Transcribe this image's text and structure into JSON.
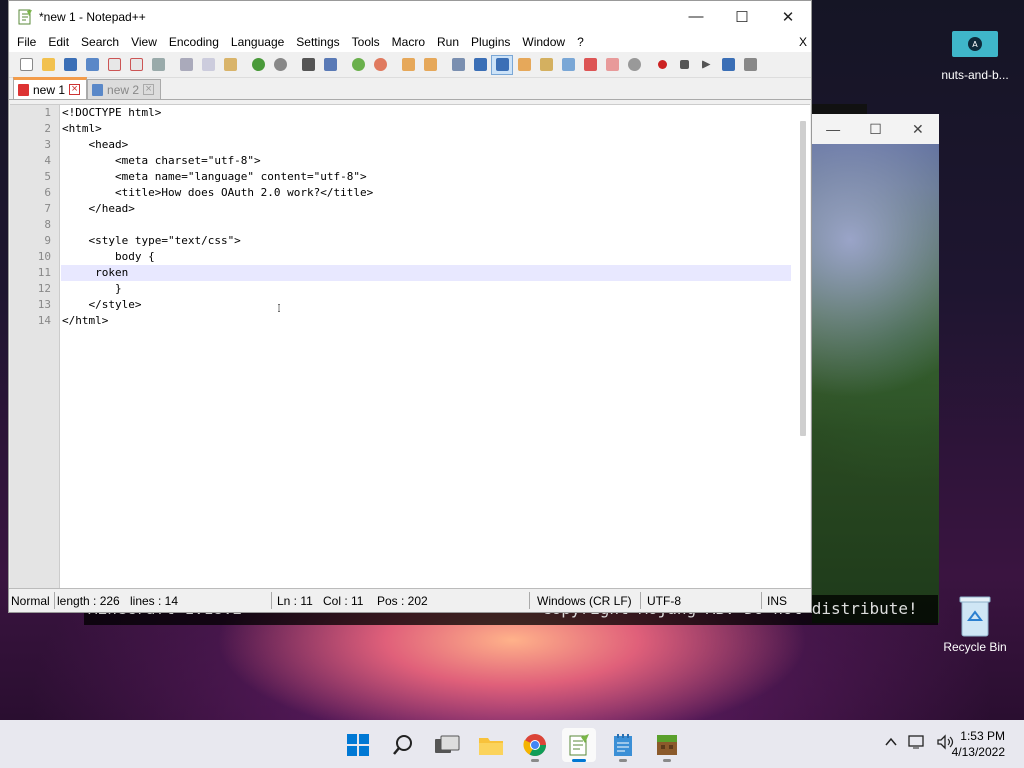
{
  "desktop": {
    "top_right_icon_label": "nuts-and-b...",
    "recycle_bin_label": "Recycle Bin"
  },
  "minecraft": {
    "version_text": "Minecraft 1.18.2",
    "copyright_text": "Copyright Mojang AB. Do not distribute!"
  },
  "notepad": {
    "window_title": "*new 1 - Notepad++",
    "menu": [
      "File",
      "Edit",
      "Search",
      "View",
      "Encoding",
      "Language",
      "Settings",
      "Tools",
      "Macro",
      "Run",
      "Plugins",
      "Window",
      "?"
    ],
    "menu_close": "X",
    "tabs": [
      {
        "label": "new 1",
        "active": true
      },
      {
        "label": "new 2",
        "active": false
      }
    ],
    "editor": {
      "lines": [
        "<!DOCTYPE html>",
        "<html>",
        "    <head>",
        "        <meta charset=\"utf-8\">",
        "        <meta name=\"language\" content=\"utf-8\">",
        "        <title>How does OAuth 2.0 work?</title>",
        "    </head>",
        "",
        "    <style type=\"text/css\">",
        "        body {",
        "     roken",
        "        }",
        "    </style>",
        "</html>"
      ],
      "line_numbers": [
        "1",
        "2",
        "3",
        "4",
        "5",
        "6",
        "7",
        "8",
        "9",
        "10",
        "11",
        "12",
        "13",
        "14"
      ],
      "current_line": 11
    },
    "status": {
      "mode": "Normal",
      "length": "length : 226",
      "lines": "lines : 14",
      "ln": "Ln : 11",
      "col": "Col : 11",
      "pos": "Pos : 202",
      "eol": "Windows (CR LF)",
      "encoding": "UTF-8",
      "ins": "INS"
    },
    "window_buttons": {
      "minimize": "—",
      "maximize": "☐",
      "close": "✕"
    }
  },
  "taskbar": {
    "time": "1:53 PM",
    "date": "4/13/2022",
    "colors": {
      "accent": "#0078d4"
    }
  }
}
